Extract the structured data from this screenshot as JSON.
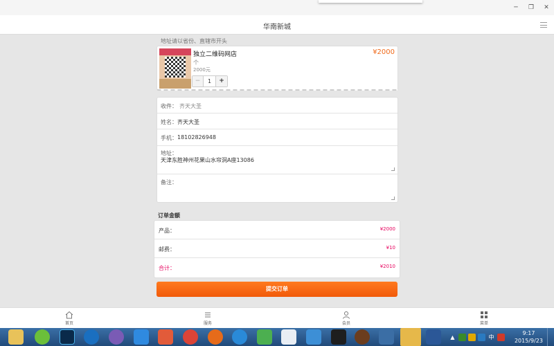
{
  "header": {
    "title": "华南新城"
  },
  "hint": "地址请以省份、直辖市开头",
  "product": {
    "name": "独立二维码网店",
    "unit": "个",
    "sub": "2000元",
    "price": "¥2000",
    "quantity": "1",
    "minus": "−",
    "plus": "+"
  },
  "form": {
    "recipient_label": "收件：",
    "recipient_value": "齐天大圣",
    "name_label": "姓名：",
    "name_value": "齐天大圣",
    "phone_label": "手机：",
    "phone_value": "18102826948",
    "address_label": "地址：",
    "address_value": "天津东胜神州花果山水帘洞A座13086",
    "note_label": "备注："
  },
  "summary": {
    "title": "订单金额",
    "product_label": "产品：",
    "product_value": "¥2000",
    "postage_label": "邮费：",
    "postage_value": "¥10",
    "total_label": "合计：",
    "total_value": "¥2010"
  },
  "submit_label": "提交订单",
  "tabbar": {
    "tabs": [
      {
        "label": "首页",
        "icon": "home-icon"
      },
      {
        "label": "服务",
        "icon": "list-icon"
      },
      {
        "label": "会员",
        "icon": "user-icon"
      },
      {
        "label": "菜单",
        "icon": "grid-icon"
      }
    ]
  },
  "taskbar": {
    "time": "9:17",
    "date": "2015/9/23",
    "ime": "中"
  }
}
